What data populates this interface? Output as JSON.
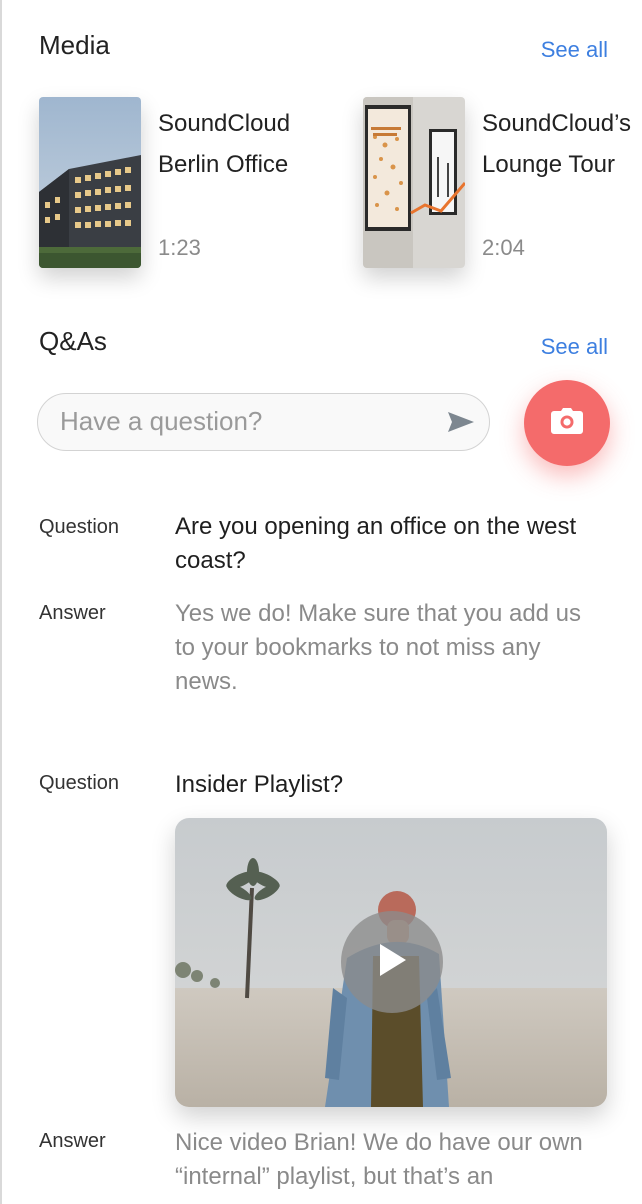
{
  "media": {
    "title": "Media",
    "see_all": "See all",
    "items": [
      {
        "title_line1": "SoundCloud",
        "title_line2": "Berlin Office",
        "duration": "1:23",
        "thumb_icon": "building-photo-icon"
      },
      {
        "title_line1": "SoundCloud’s",
        "title_line2": "Lounge Tour",
        "duration": "2:04",
        "thumb_icon": "framed-poster-photo-icon"
      }
    ]
  },
  "qas": {
    "title": "Q&As",
    "see_all": "See all",
    "ask_placeholder": "Have a question?",
    "ask_value": "",
    "send_icon": "send-icon",
    "camera_icon": "camera-icon",
    "accent_color": "#f46b6b",
    "link_color": "#3d7fe0",
    "items": [
      {
        "question_label": "Question",
        "question": "Are you opening an office on the west coast?",
        "answer_label": "Answer",
        "answer": "Yes we do! Make sure that you add us to your bookmarks to not miss any news."
      },
      {
        "question_label": "Question",
        "question": "Insider Playlist?",
        "media_icon": "play-icon",
        "answer_label": "Answer",
        "answer": "Nice video Brian! We do have our own “internal” playlist, but that’s an"
      }
    ]
  }
}
